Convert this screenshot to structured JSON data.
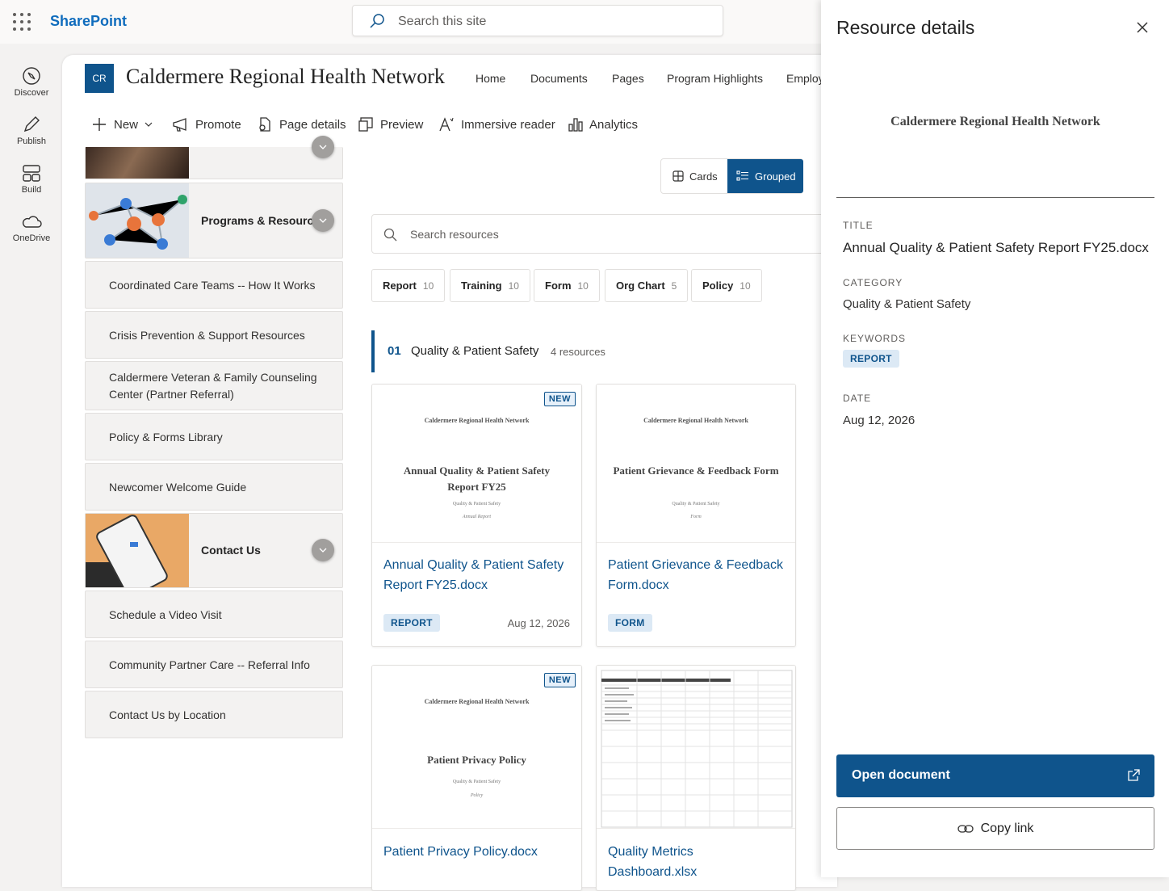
{
  "app": {
    "name": "SharePoint",
    "search_placeholder": "Search this site"
  },
  "rail": [
    {
      "label": "Discover",
      "icon": "compass-icon"
    },
    {
      "label": "Publish",
      "icon": "pencil-icon"
    },
    {
      "label": "Build",
      "icon": "layout-icon"
    },
    {
      "label": "OneDrive",
      "icon": "cloud-icon"
    }
  ],
  "site": {
    "logo": "CR",
    "title": "Caldermere Regional Health Network",
    "nav": [
      "Home",
      "Documents",
      "Pages",
      "Program Highlights",
      "Employ"
    ]
  },
  "commands": [
    "New",
    "Promote",
    "Page details",
    "Preview",
    "Immersive reader",
    "Analytics"
  ],
  "tiles": [
    "Programs & Resources",
    "Coordinated Care Teams -- How It Works",
    "Crisis Prevention & Support Resources",
    "Caldermere Veteran & Family Counseling Center (Partner Referral)",
    "Policy & Forms Library",
    "Newcomer Welcome Guide",
    "Contact Us",
    "Schedule a Video Visit",
    "Community Partner Care -- Referral Info",
    "Contact Us by Location"
  ],
  "view": {
    "cards": "Cards",
    "grouped": "Grouped",
    "active": "Grouped"
  },
  "resources": {
    "search_placeholder": "Search resources",
    "filters": [
      {
        "label": "Report",
        "count": "10"
      },
      {
        "label": "Training",
        "count": "10"
      },
      {
        "label": "Form",
        "count": "10"
      },
      {
        "label": "Org Chart",
        "count": "5"
      },
      {
        "label": "Policy",
        "count": "10"
      }
    ],
    "group": {
      "num": "01",
      "name": "Quality & Patient Safety",
      "count": "4 resources"
    },
    "cards": [
      {
        "preview_org": "Caldermere Regional Health Network",
        "preview_title": "Annual Quality & Patient Safety Report FY25",
        "preview_cat": "Quality & Patient Safety",
        "preview_kind": "Annual Report",
        "name": "Annual Quality & Patient Safety Report FY25.docx",
        "tag": "REPORT",
        "date": "Aug 12, 2026",
        "badge": "NEW"
      },
      {
        "preview_org": "Caldermere Regional Health Network",
        "preview_title": "Patient Grievance & Feedback Form",
        "preview_cat": "Quality & Patient Safety",
        "preview_kind": "Form",
        "name": "Patient Grievance & Feedback Form.docx",
        "tag": "FORM",
        "date": "",
        "badge": ""
      },
      {
        "preview_org": "Caldermere Regional Health Network",
        "preview_title": "Patient Privacy Policy",
        "preview_cat": "Quality & Patient Safety",
        "preview_kind": "Policy",
        "name": "Patient Privacy Policy.docx",
        "tag": "",
        "date": "",
        "badge": "NEW"
      },
      {
        "name": "Quality Metrics Dashboard.xlsx"
      }
    ]
  },
  "panel": {
    "title": "Resource details",
    "preview_org": "Caldermere Regional Health Network",
    "title_label": "TITLE",
    "title_value": "Annual Quality & Patient Safety Report FY25.docx",
    "category_label": "CATEGORY",
    "category_value": "Quality & Patient Safety",
    "keywords_label": "KEYWORDS",
    "keyword": "REPORT",
    "date_label": "DATE",
    "date_value": "Aug 12, 2026",
    "open_label": "Open document",
    "copy_label": "Copy link"
  }
}
